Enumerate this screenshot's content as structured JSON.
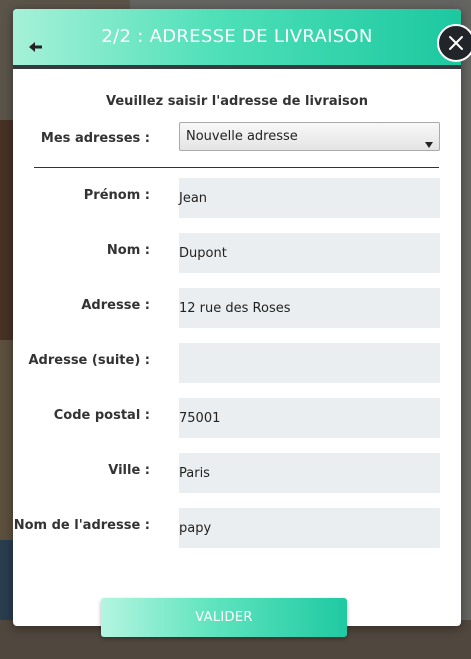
{
  "modal": {
    "title": "2/2 : ADRESSE DE LIVRAISON",
    "accent_gradient": [
      "#a6f1d8",
      "#1cc8a0"
    ],
    "instructions": "Veuillez saisir l'adresse de livraison"
  },
  "addresses": {
    "label": "Mes adresses :",
    "selected": "Nouvelle adresse"
  },
  "fields": [
    {
      "label": "Prénom :",
      "value": "Jean"
    },
    {
      "label": "Nom :",
      "value": "Dupont"
    },
    {
      "label": "Adresse :",
      "value": "12 rue des Roses"
    },
    {
      "label": "Adresse (suite) :",
      "value": ""
    },
    {
      "label": "Code postal :",
      "value": "75001"
    },
    {
      "label": "Ville :",
      "value": "Paris"
    },
    {
      "label": "Nom de l'adresse :",
      "value": "papy"
    }
  ],
  "submit": {
    "label": "VALIDER"
  },
  "icons": {
    "back": "arrow-left-icon",
    "close": "close-icon",
    "dropdown": "caret-down-icon"
  }
}
